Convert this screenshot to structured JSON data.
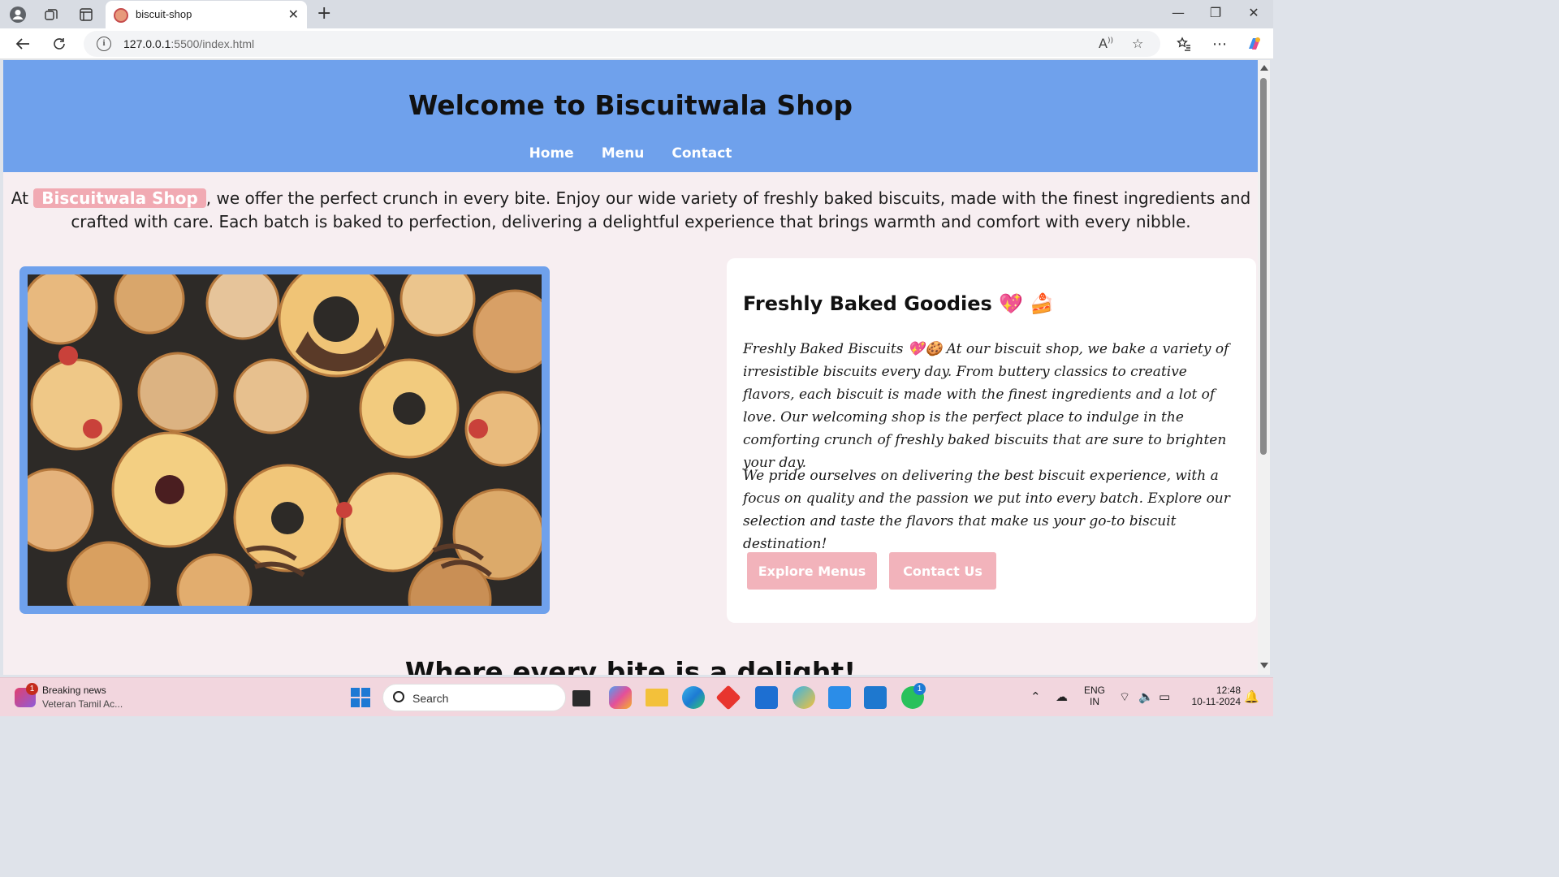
{
  "browser": {
    "tab_title": "biscuit-shop",
    "url_host": "127.0.0.1",
    "url_path": ":5500/index.html",
    "new_tab_glyph": "+",
    "close_glyph": "✕"
  },
  "site": {
    "title": "Welcome to Biscuitwala Shop",
    "nav": [
      "Home",
      "Menu",
      "Contact"
    ],
    "intro_prefix": "At ",
    "intro_brand": "Biscuitwala Shop",
    "intro_rest": ", we offer the perfect crunch in every bite. Enjoy our wide variety of freshly baked biscuits, made with the finest ingredients and crafted with care. Each batch is baked to perfection, delivering a delightful experience that brings warmth and comfort with every nibble.",
    "card": {
      "title": "Freshly Baked Goodies 💖 🍰",
      "p1": "Freshly Baked Biscuits 💖🍪 At our biscuit shop, we bake a variety of irresistible biscuits every day. From buttery classics to creative flavors, each biscuit is made with the finest ingredients and a lot of love. Our welcoming shop is the perfect place to indulge in the comforting crunch of freshly baked biscuits that are sure to brighten your day.",
      "p2": "We pride ourselves on delivering the best biscuit experience, with a focus on quality and the passion we put into every batch. Explore our selection and taste the flavors that make us your go-to biscuit destination!",
      "btn_explore": "Explore Menus",
      "btn_contact": "Contact Us"
    },
    "section_heading": "Where every bite is a delight!"
  },
  "taskbar": {
    "news_badge": "1",
    "news_title": "Breaking news",
    "news_sub": "Veteran Tamil Ac...",
    "search_label": "Search",
    "whatsapp_badge": "1",
    "lang_1": "ENG",
    "lang_2": "IN",
    "time": "12:48",
    "date": "10-11-2024"
  },
  "colors": {
    "header_blue": "#6fa1ec",
    "badge_pink": "#f1aab3",
    "page_bg": "#f7eef1"
  }
}
